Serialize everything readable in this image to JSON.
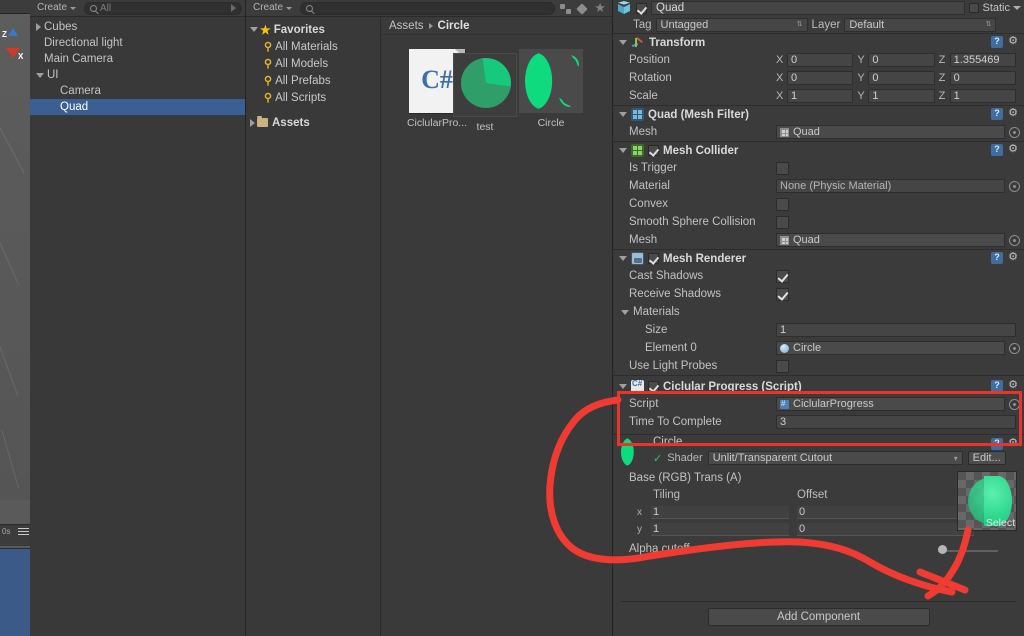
{
  "scene_view": {
    "axis_z_label": "Z",
    "axis_x_label": "X",
    "stats_label": "0s"
  },
  "hierarchy": {
    "toolbar": {
      "create_label": "Create",
      "search_placeholder": "All"
    },
    "items": [
      {
        "label": "Cubes",
        "indent": 0,
        "arrow": "collapsed",
        "selected": false
      },
      {
        "label": "Directional light",
        "indent": 0,
        "arrow": "none",
        "selected": false
      },
      {
        "label": "Main Camera",
        "indent": 0,
        "arrow": "none",
        "selected": false
      },
      {
        "label": "UI",
        "indent": 0,
        "arrow": "expanded",
        "selected": false
      },
      {
        "label": "Camera",
        "indent": 1,
        "arrow": "none",
        "selected": false
      },
      {
        "label": "Quad",
        "indent": 1,
        "arrow": "none",
        "selected": true
      }
    ]
  },
  "project": {
    "toolbar": {
      "create_label": "Create",
      "search_placeholder": ""
    },
    "tree": [
      {
        "label": "Favorites",
        "icon": "star-icon",
        "arrow": "expanded",
        "bold": true
      },
      {
        "label": "All Materials",
        "icon": "search-icon",
        "arrow": "none",
        "bold": false
      },
      {
        "label": "All Models",
        "icon": "search-icon",
        "arrow": "none",
        "bold": false
      },
      {
        "label": "All Prefabs",
        "icon": "search-icon",
        "arrow": "none",
        "bold": false
      },
      {
        "label": "All Scripts",
        "icon": "search-icon",
        "arrow": "none",
        "bold": false
      },
      {
        "label": "Assets",
        "icon": "folder-icon",
        "arrow": "collapsed",
        "bold": true
      }
    ],
    "breadcrumb": {
      "root": "Assets",
      "current": "Circle"
    },
    "assets": [
      {
        "label": "CiclularPro...",
        "type": "csharp-script"
      },
      {
        "label": "Circle",
        "type": "material"
      },
      {
        "label": "test",
        "type": "texture"
      }
    ]
  },
  "inspector": {
    "object_name": "Quad",
    "object_enabled": true,
    "static_label": "Static",
    "tag_label": "Tag",
    "tag_value": "Untagged",
    "layer_label": "Layer",
    "layer_value": "Default",
    "transform": {
      "title": "Transform",
      "rows": [
        {
          "name": "Position",
          "x": "0",
          "y": "0",
          "z": "1.355469"
        },
        {
          "name": "Rotation",
          "x": "0",
          "y": "0",
          "z": "0"
        },
        {
          "name": "Scale",
          "x": "1",
          "y": "1",
          "z": "1"
        }
      ],
      "axis_labels": [
        "X",
        "Y",
        "Z"
      ]
    },
    "mesh_filter": {
      "title": "Quad (Mesh Filter)",
      "mesh_label": "Mesh",
      "mesh_value": "Quad"
    },
    "mesh_collider": {
      "title": "Mesh Collider",
      "enabled": true,
      "is_trigger_label": "Is Trigger",
      "is_trigger_value": false,
      "material_label": "Material",
      "material_value": "None (Physic Material)",
      "convex_label": "Convex",
      "convex_value": false,
      "smooth_label": "Smooth Sphere Collision",
      "smooth_value": false,
      "mesh_label": "Mesh",
      "mesh_value": "Quad"
    },
    "mesh_renderer": {
      "title": "Mesh Renderer",
      "enabled": true,
      "cast_shadows_label": "Cast Shadows",
      "cast_shadows_value": true,
      "receive_shadows_label": "Receive Shadows",
      "receive_shadows_value": true,
      "materials_label": "Materials",
      "size_label": "Size",
      "size_value": "1",
      "element0_label": "Element 0",
      "element0_value": "Circle",
      "light_probes_label": "Use Light Probes",
      "light_probes_value": false
    },
    "script_component": {
      "title": "Ciclular Progress (Script)",
      "enabled": true,
      "script_label": "Script",
      "script_value": "CiclularProgress",
      "time_label": "Time To Complete",
      "time_value": "3",
      "highlight_color": "#e8352b"
    },
    "material": {
      "name": "Circle",
      "shader_label": "Shader",
      "shader_value": "Unlit/Transparent Cutout",
      "edit_label": "Edit...",
      "texture_label": "Base (RGB) Trans (A)",
      "tiling_label": "Tiling",
      "offset_label": "Offset",
      "axis_x": "x",
      "axis_y": "y",
      "tiling_x": "1",
      "tiling_y": "1",
      "offset_x": "0",
      "offset_y": "0",
      "select_label": "Select",
      "alpha_label": "Alpha cutoff",
      "alpha_value": 0
    },
    "add_component_label": "Add Component"
  },
  "annotation": {
    "color": "#ef3b32",
    "type": "freehand-arrow"
  }
}
